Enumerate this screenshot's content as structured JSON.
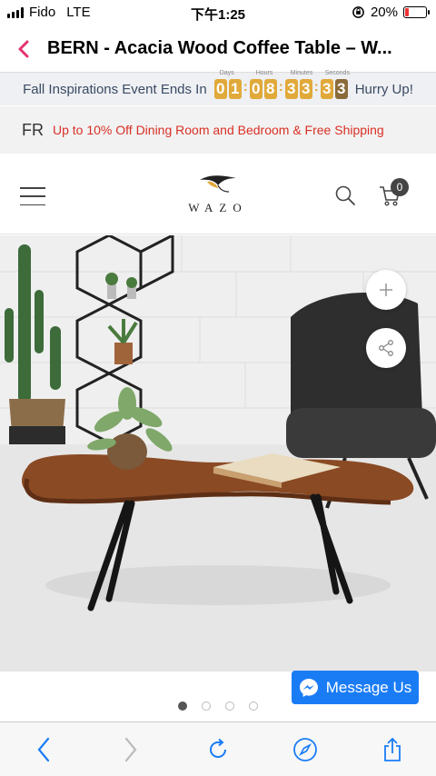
{
  "status": {
    "carrier": "Fido",
    "network": "LTE",
    "time": "下午1:25",
    "battery": "20%",
    "battery_level": 0.2
  },
  "title_bar": {
    "title": "BERN - Acacia Wood Coffee Table – W..."
  },
  "event": {
    "left_text": "Fall Inspirations Event Ends In",
    "right_text": "Hurry Up!",
    "units": [
      "Days",
      "Hours",
      "Minutes",
      "Seconds"
    ],
    "digits": [
      "0",
      "1",
      "0",
      "8",
      "3",
      "3",
      "3",
      "3"
    ]
  },
  "promo": {
    "lang": "FR",
    "text": "Up to 10% Off Dining Room and Bedroom & Free Shipping"
  },
  "header": {
    "logo": "WAZO",
    "cart_count": "0"
  },
  "chat": {
    "label": "Message Us"
  },
  "colors": {
    "accent": "#e6336f",
    "promo_red": "#d93025",
    "messenger_blue": "#1a7cf5",
    "timer_gold": "#e0a93a"
  }
}
